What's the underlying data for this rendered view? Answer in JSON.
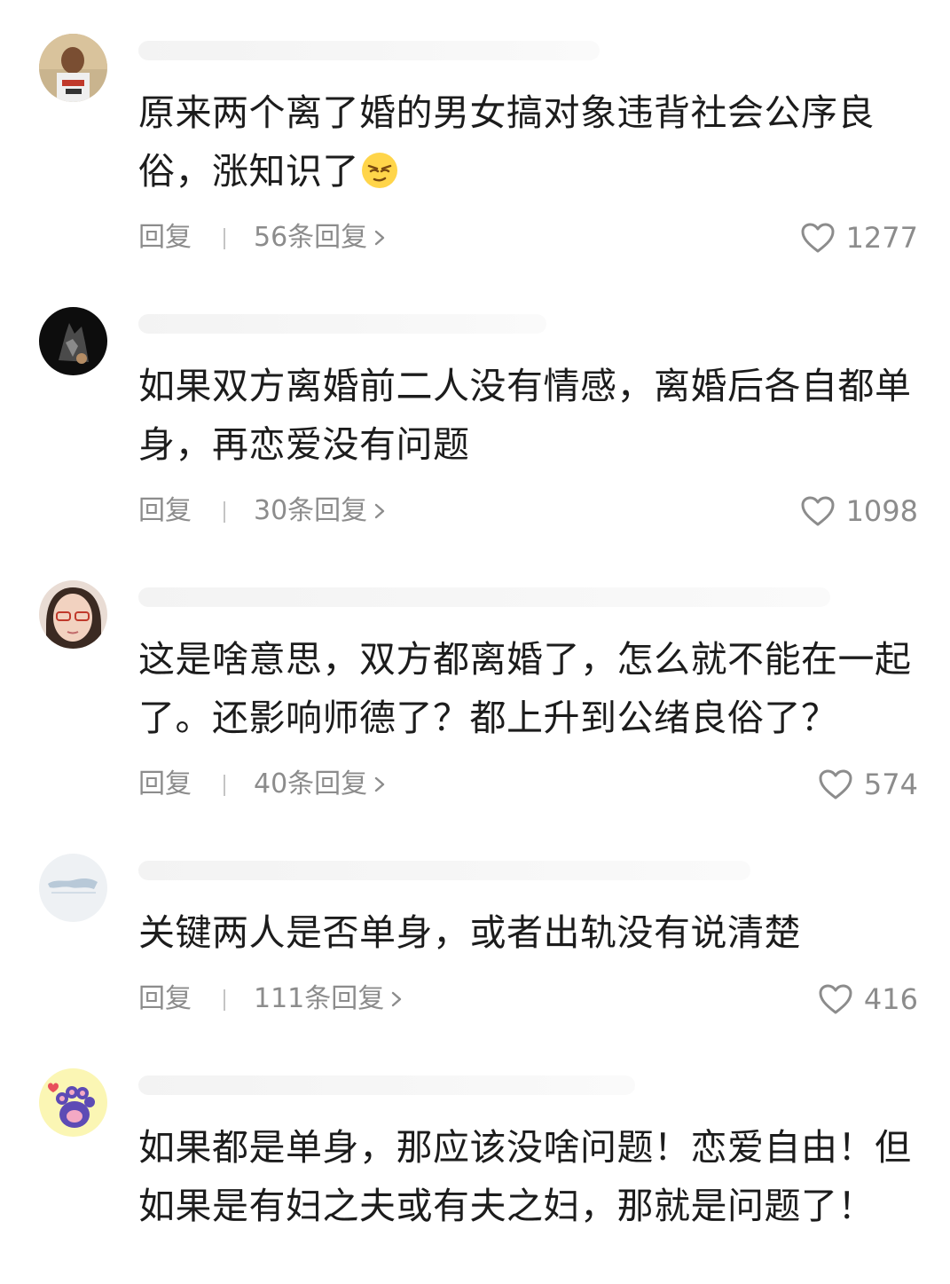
{
  "comments": [
    {
      "text": "原来两个离了婚的男女搞对象违背社会公序良俗，涨知识了",
      "emoji": "smirk-face-emoji",
      "reply_label": "回复",
      "replies_label": "56条回复",
      "likes": "1277"
    },
    {
      "text": "如果双方离婚前二人没有情感，离婚后各自都单身，再恋爱没有问题",
      "reply_label": "回复",
      "replies_label": "30条回复",
      "likes": "1098"
    },
    {
      "text": "这是啥意思，双方都离婚了，怎么就不能在一起了。还影响师德了？都上升到公绪良俗了？",
      "reply_label": "回复",
      "replies_label": "40条回复",
      "likes": "574"
    },
    {
      "text": "关键两人是否单身，或者出轨没有说清楚",
      "reply_label": "回复",
      "replies_label": "111条回复",
      "likes": "416"
    },
    {
      "text": "如果都是单身，那应该没啥问题！恋爱自由！但如果是有妇之夫或有夫之妇，那就是问题了！"
    }
  ],
  "colors": {
    "text": "#1c1c1c",
    "meta": "#8c8c8c",
    "background": "#ffffff"
  }
}
